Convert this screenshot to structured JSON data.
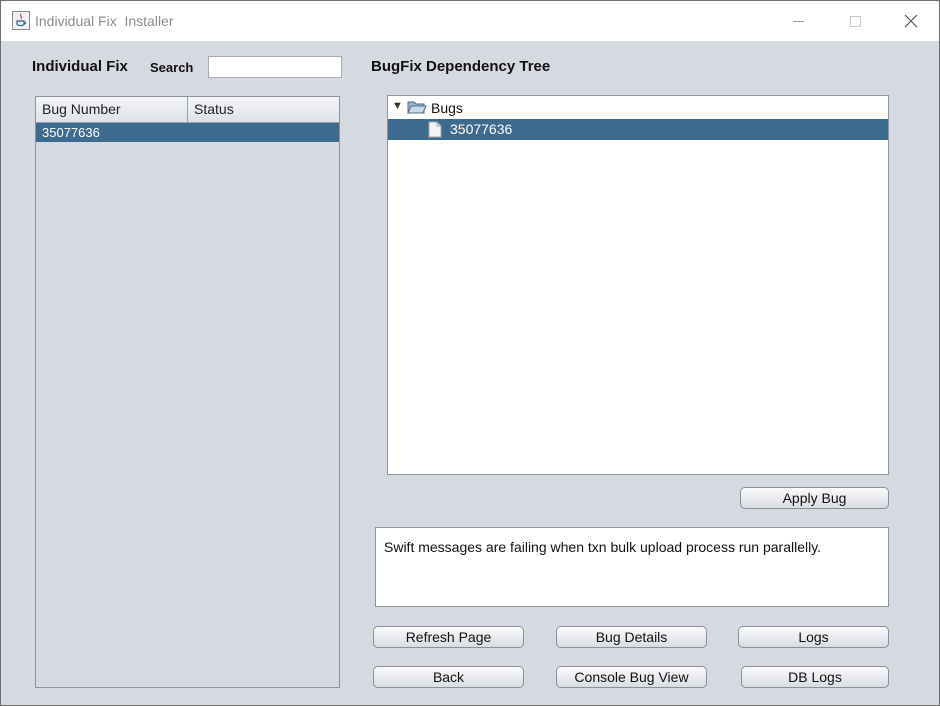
{
  "window": {
    "title": "Individual Fix  Installer"
  },
  "left": {
    "heading": "Individual Fix",
    "search_label": "Search",
    "search_value": "",
    "table": {
      "columns": [
        "Bug Number",
        "Status"
      ],
      "rows": [
        {
          "bug_number": "35077636",
          "status": ""
        }
      ]
    }
  },
  "right": {
    "heading": "BugFix Dependency Tree",
    "tree": {
      "root": {
        "label": "Bugs",
        "expanded": true,
        "icon": "folder-open-icon"
      },
      "children": [
        {
          "label": "35077636",
          "icon": "file-icon",
          "selected": true
        }
      ]
    },
    "apply_label": "Apply Bug",
    "description": "Swift messages are failing when txn bulk upload process run parallelly."
  },
  "buttons": {
    "refresh": "Refresh Page",
    "details": "Bug Details",
    "logs": "Logs",
    "back": "Back",
    "console": "Console Bug View",
    "db_logs": "DB Logs"
  },
  "colors": {
    "selection": "#3c6b8f",
    "panel_background": "#d6d9df"
  }
}
